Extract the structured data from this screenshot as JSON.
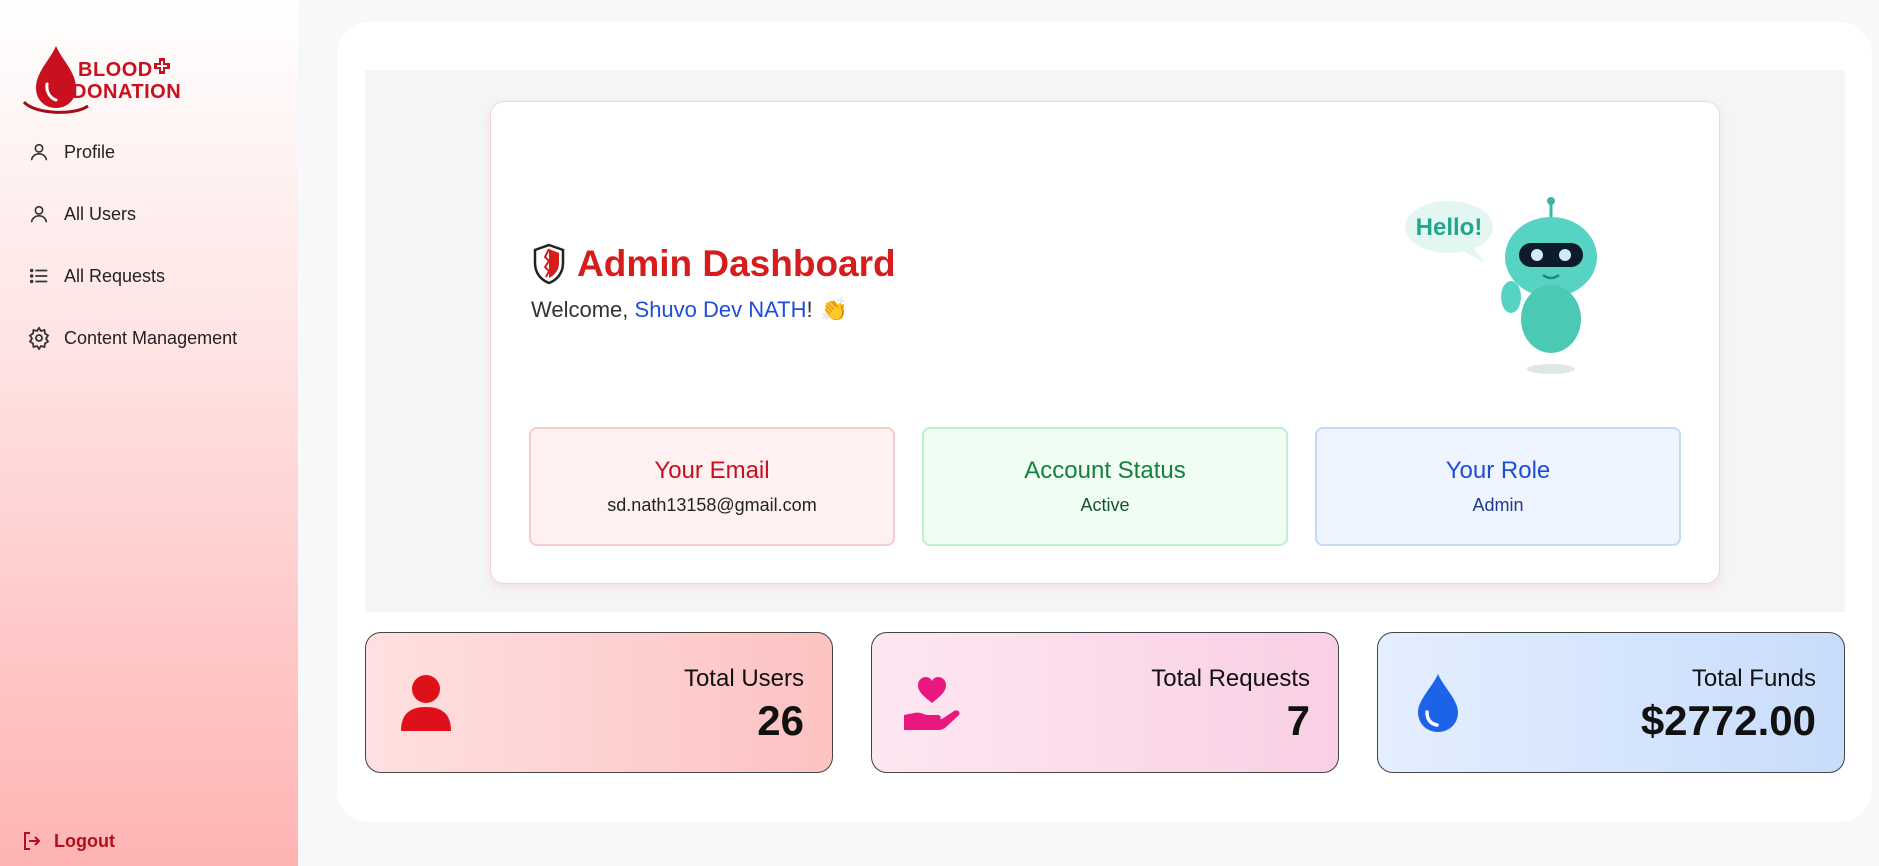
{
  "brand": {
    "line1": "BLOOD",
    "line2": "DONATION",
    "color": "#c8101e"
  },
  "sidebar": {
    "items": [
      {
        "label": "Profile",
        "icon": "user-icon"
      },
      {
        "label": "All Users",
        "icon": "user-icon"
      },
      {
        "label": "All Requests",
        "icon": "list-icon"
      },
      {
        "label": "Content Management",
        "icon": "gear-icon"
      }
    ],
    "logout": {
      "label": "Logout",
      "icon": "logout-icon"
    }
  },
  "hero": {
    "title": "Admin Dashboard",
    "welcome_prefix": "Welcome, ",
    "user_name": "Shuvo Dev NATH",
    "welcome_suffix": "!",
    "wave_emoji": "👏",
    "robot_bubble": "Hello!"
  },
  "info": {
    "email": {
      "heading": "Your Email",
      "value": "sd.nath13158@gmail.com"
    },
    "status": {
      "heading": "Account Status",
      "value": "Active"
    },
    "role": {
      "heading": "Your Role",
      "value": "Admin"
    }
  },
  "stats": {
    "users": {
      "label": "Total Users",
      "value": "26",
      "icon": "user-icon",
      "color": "#e0101a"
    },
    "requests": {
      "label": "Total Requests",
      "value": "7",
      "icon": "hand-heart-icon",
      "color": "#e8187e"
    },
    "funds": {
      "label": "Total Funds",
      "value": "$2772.00",
      "icon": "drop-icon",
      "color": "#1d63e8"
    }
  },
  "colors": {
    "accent_red": "#d61d1d",
    "accent_blue": "#1d4ed8",
    "accent_green": "#15803d"
  }
}
